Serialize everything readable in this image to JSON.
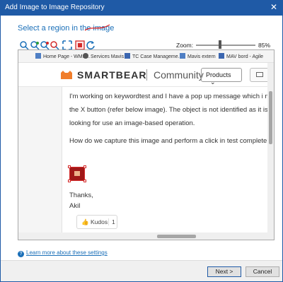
{
  "window": {
    "title": "Add Image to Image Repository",
    "close_glyph": "✕"
  },
  "heading": "Select a region in the image",
  "toolbar": {
    "tools": [
      "region-select-icon",
      "region-add-icon",
      "region-remove-icon",
      "region-exclude-icon",
      "fit-icon",
      "crop-region-icon",
      "refresh-icon"
    ],
    "zoom_label": "Zoom:",
    "zoom_level": 0.4,
    "zoom_value": "85%"
  },
  "screenshot": {
    "bookmarks": [
      {
        "label": "Home Page - WMS...",
        "icon": "page-icon"
      },
      {
        "label": "Services Mavis",
        "icon": "globe-icon"
      },
      {
        "label": "TC Case Manageme...",
        "icon": "tc-icon"
      },
      {
        "label": "Mavis extern",
        "icon": "mavis-icon"
      },
      {
        "label": "MAV bord - Agile",
        "icon": "agile-icon"
      }
    ],
    "site": {
      "brand": "SMARTBEAR",
      "section": "Community",
      "products_button": "Products",
      "products_chevron": "⌄"
    },
    "post": {
      "line1": "I'm working on keywordtest and I have a pop up message which i nee",
      "line2": "the X button (refer below image). The object is not identified as it is a",
      "line3": "looking for use an image-based operation.",
      "line4": "How do we capture this image and perform a click in test complete",
      "sign1": "Thanks,",
      "sign2": "Akil"
    },
    "kudos": {
      "label": "Kudos",
      "count": "1"
    }
  },
  "learn_more": "Learn more about these settings",
  "buttons": {
    "next": "Next >",
    "cancel": "Cancel"
  }
}
